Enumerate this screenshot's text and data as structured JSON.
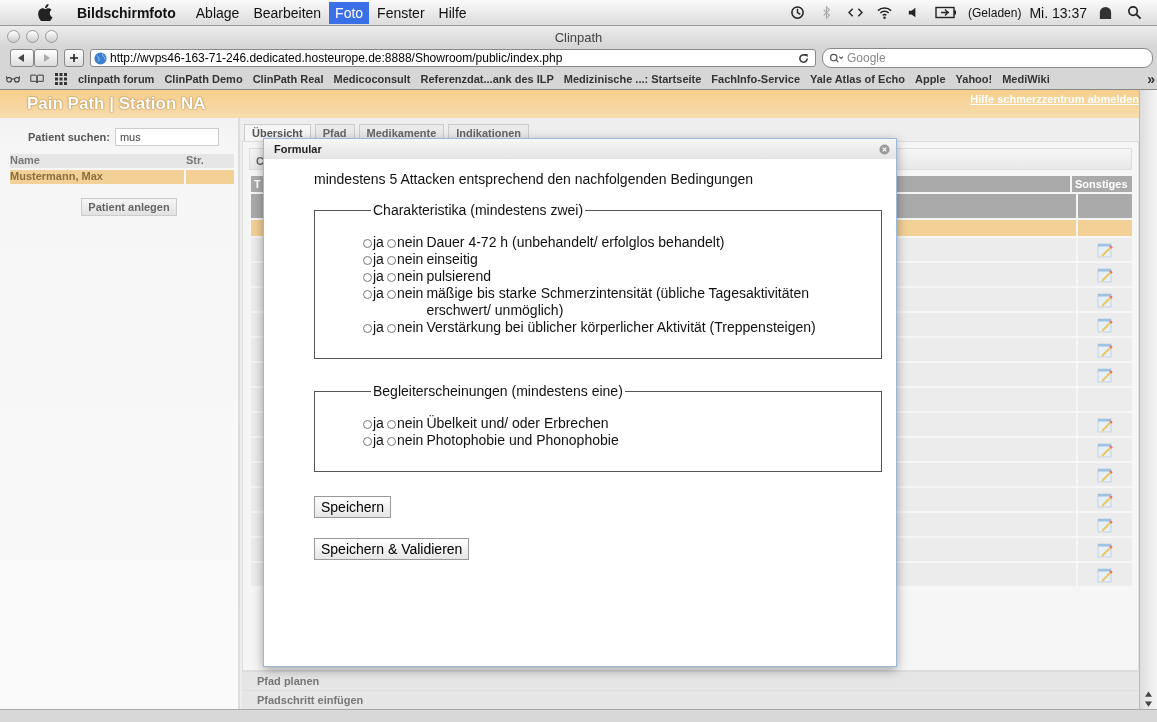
{
  "menubar": {
    "app": "Bildschirmfoto",
    "menus": [
      {
        "label": "Ablage",
        "selected": false
      },
      {
        "label": "Bearbeiten",
        "selected": false
      },
      {
        "label": "Foto",
        "selected": true
      },
      {
        "label": "Fenster",
        "selected": false
      },
      {
        "label": "Hilfe",
        "selected": false
      }
    ],
    "battery": "(Geladen)",
    "clock": "Mi. 13:37"
  },
  "browser": {
    "title": "Clinpath",
    "url": "http://wvps46-163-71-246.dedicated.hosteurope.de:8888/Showroom/public/index.php",
    "search_placeholder": "Google",
    "bookmarks": [
      "clinpath forum",
      "ClinPath Demo",
      "ClinPath Real",
      "Medicoconsult",
      "Referenzdat...ank des ILP",
      "Medizinische ...: Startseite",
      "FachInfo-Service",
      "Yale Atlas of Echo",
      "Apple",
      "Yahoo!",
      "MediWiki"
    ],
    "more": "»"
  },
  "header": {
    "title": "Pain Path | Station NA",
    "link": "Hilfe schmerzzentrum abmelden"
  },
  "sidebar": {
    "search_label": "Patient suchen:",
    "search_value": "mus",
    "columns": [
      "Name",
      "Str."
    ],
    "patients": [
      {
        "name": "Mustermann, Max",
        "selected": true
      }
    ],
    "button": "Patient anlegen"
  },
  "tabs": [
    {
      "label": "Übersicht",
      "selected": true
    },
    {
      "label": "Pfad",
      "selected": false
    },
    {
      "label": "Medikamente",
      "selected": false
    },
    {
      "label": "Indikationen",
      "selected": false
    }
  ],
  "subtab_fragment": "C",
  "table": {
    "header_fragment": "T",
    "last_column": "Sonstiges",
    "rows": [
      {
        "selected": true,
        "note": false
      },
      {
        "selected": false,
        "note": true
      },
      {
        "selected": false,
        "note": true
      },
      {
        "selected": false,
        "note": true
      },
      {
        "selected": false,
        "note": true
      },
      {
        "selected": false,
        "note": true
      },
      {
        "selected": false,
        "note": true
      },
      {
        "selected": false,
        "note": false
      },
      {
        "selected": false,
        "note": true
      },
      {
        "selected": false,
        "note": true
      },
      {
        "selected": false,
        "note": true
      },
      {
        "selected": false,
        "note": true
      },
      {
        "selected": false,
        "note": true
      },
      {
        "selected": false,
        "note": true
      },
      {
        "selected": false,
        "note": true
      }
    ]
  },
  "accordion": [
    "Pfad planen",
    "Pfadschritt einfügen"
  ],
  "dialog": {
    "title": "Formular",
    "intro": "mindestens 5 Attacken entsprechend den nachfolgenden Bedingungen",
    "groups": [
      {
        "legend": "Charakteristika (mindestens zwei)",
        "questions": [
          {
            "text": "Dauer 4-72 h (unbehandelt/ erfolglos behandelt)",
            "options": [
              {
                "label": "ja",
                "selected": false
              },
              {
                "label": "nein",
                "selected": false
              }
            ]
          },
          {
            "text": "einseitig",
            "options": [
              {
                "label": "ja",
                "selected": false
              },
              {
                "label": "nein",
                "selected": false
              }
            ]
          },
          {
            "text": "pulsierend",
            "options": [
              {
                "label": "ja",
                "selected": false
              },
              {
                "label": "nein",
                "selected": false
              }
            ]
          },
          {
            "text": "mäßige bis starke Schmerzintensität (übliche Tagesaktivitäten erschwert/ unmöglich)",
            "options": [
              {
                "label": "ja",
                "selected": false
              },
              {
                "label": "nein",
                "selected": false
              }
            ]
          },
          {
            "text": "Verstärkung bei üblicher körperlicher Aktivität (Treppensteigen)",
            "options": [
              {
                "label": "ja",
                "selected": false
              },
              {
                "label": "nein",
                "selected": false
              }
            ]
          }
        ]
      },
      {
        "legend": "Begleiterscheinungen (mindestens eine)",
        "questions": [
          {
            "text": "Übelkeit und/ oder Erbrechen",
            "options": [
              {
                "label": "ja",
                "selected": false
              },
              {
                "label": "nein",
                "selected": false
              }
            ]
          },
          {
            "text": "Photophobie und Phonophobie",
            "options": [
              {
                "label": "ja",
                "selected": false
              },
              {
                "label": "nein",
                "selected": false
              }
            ]
          }
        ]
      }
    ],
    "buttons": [
      "Speichern",
      "Speichern & Validieren"
    ]
  }
}
